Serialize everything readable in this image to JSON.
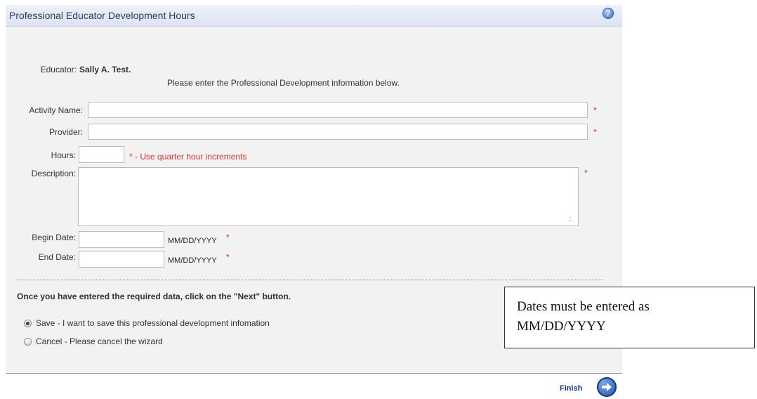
{
  "header": {
    "title": "Professional Educator Development Hours",
    "help_icon": "?"
  },
  "educator": {
    "label": "Educator:",
    "name": "Sally A. Test."
  },
  "instructions": "Please enter the Professional Development information below.",
  "fields": {
    "activity_name": {
      "label": "Activity Name:",
      "value": ""
    },
    "provider": {
      "label": "Provider:",
      "value": ""
    },
    "hours": {
      "label": "Hours:",
      "value": "",
      "hint": "* - Use quarter hour increments"
    },
    "description": {
      "label": "Description:",
      "value": ""
    },
    "begin_date": {
      "label": "Begin Date:",
      "value": "",
      "format": "MM/DD/YYYY"
    },
    "end_date": {
      "label": "End Date:",
      "value": "",
      "format": "MM/DD/YYYY"
    }
  },
  "required_mark": "*",
  "next_prompt": "Once you have entered the required data, click on the \"Next\" button.",
  "options": [
    {
      "label": "Save - I want to save this professional development infomation",
      "selected": true
    },
    {
      "label": "Cancel - Please cancel the wizard",
      "selected": false
    }
  ],
  "footer": {
    "finish_label": "Finish"
  },
  "callout": {
    "line1": "Dates must be entered as",
    "line2": "MM/DD/YYYY"
  }
}
